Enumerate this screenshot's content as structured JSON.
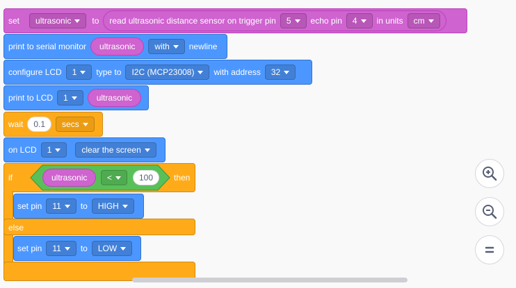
{
  "blocks": {
    "set_ultrasonic": {
      "set": "set",
      "var": "ultrasonic",
      "to": "to",
      "read": "read ultrasonic distance sensor on trigger pin",
      "trig": "5",
      "echo": "echo pin",
      "echo_pin": "4",
      "units": "in units",
      "unit": "cm"
    },
    "print_serial": {
      "label": "print to serial monitor",
      "var": "ultrasonic",
      "with": "with",
      "newline": "newline"
    },
    "configure_lcd": {
      "label": "configure LCD",
      "lcd": "1",
      "type_to": "type to",
      "type": "I2C (MCP23008)",
      "with_address": "with address",
      "address": "32"
    },
    "print_lcd": {
      "label": "print to LCD",
      "lcd": "1",
      "var": "ultrasonic"
    },
    "wait": {
      "label": "wait",
      "value": "0.1",
      "unit": "secs"
    },
    "on_lcd": {
      "label": "on LCD",
      "lcd": "1",
      "action": "clear the screen"
    },
    "if_block": {
      "if": "if",
      "var": "ultrasonic",
      "op": "<",
      "value": "100",
      "then": "then",
      "set_pin_1": {
        "label": "set pin",
        "pin": "11",
        "to": "to",
        "state": "HIGH"
      },
      "else": "else",
      "set_pin_2": {
        "label": "set pin",
        "pin": "11",
        "to": "to",
        "state": "LOW"
      }
    }
  },
  "zoom": {
    "in_label": "zoom in",
    "out_label": "zoom out",
    "reset_label": "reset zoom"
  }
}
